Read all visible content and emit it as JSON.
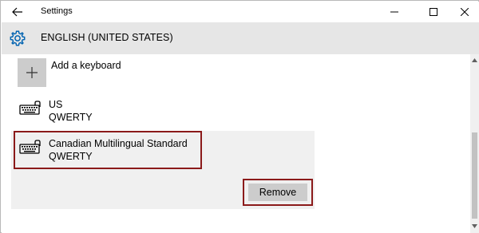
{
  "window": {
    "title": "Settings",
    "back_icon": "back-arrow-icon",
    "minimize_icon": "minimize-icon",
    "maximize_icon": "maximize-icon",
    "close_icon": "close-icon"
  },
  "header": {
    "icon": "gear-icon",
    "title": "ENGLISH (UNITED STATES)",
    "background": "#e6e6e6",
    "accent": "#0063b1"
  },
  "add_keyboard": {
    "icon": "plus-icon",
    "label": "Add a keyboard"
  },
  "keyboards": [
    {
      "icon": "keyboard-icon",
      "name": "US",
      "layout": "QWERTY",
      "selected": false
    },
    {
      "icon": "keyboard-icon",
      "name": "Canadian Multilingual Standard",
      "layout": "QWERTY",
      "selected": true
    }
  ],
  "actions": {
    "remove_label": "Remove",
    "highlight_color": "#8b1a1a"
  }
}
